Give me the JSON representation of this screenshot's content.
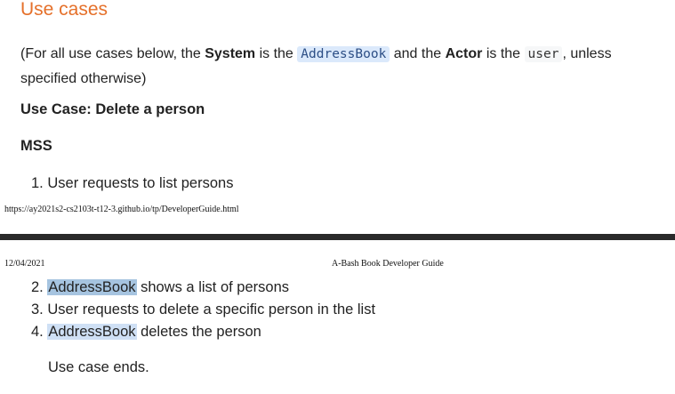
{
  "section": {
    "title": "Use cases"
  },
  "intro": {
    "part1": "(For all use cases below, the ",
    "system_bold": "System",
    "part2": " is the ",
    "system_code": "AddressBook",
    "part3": " and the ",
    "actor_bold": "Actor",
    "part4": " is the ",
    "actor_code": "user",
    "part5": ", unless specified otherwise)"
  },
  "use_case": {
    "title": "Use Case: Delete a person",
    "mss_label": "MSS"
  },
  "steps": [
    {
      "num": "1.",
      "text": "User requests to list persons"
    },
    {
      "num": "2.",
      "highlight": "AddressBook",
      "text": " shows a list of persons"
    },
    {
      "num": "3.",
      "text": "User requests to delete a specific person in the list"
    },
    {
      "num": "4.",
      "highlight": "AddressBook",
      "text": " deletes the person"
    }
  ],
  "end_text": "Use case ends.",
  "print": {
    "footer_url": "https://ay2021s2-cs2103t-t12-3.github.io/tp/DeveloperGuide.html",
    "header_date": "12/04/2021",
    "header_title": "A-Bash Book Developer Guide"
  },
  "colors": {
    "heading": "#e5702a",
    "code_highlight": "#dbe9fb",
    "divider": "#2a2a2a"
  }
}
